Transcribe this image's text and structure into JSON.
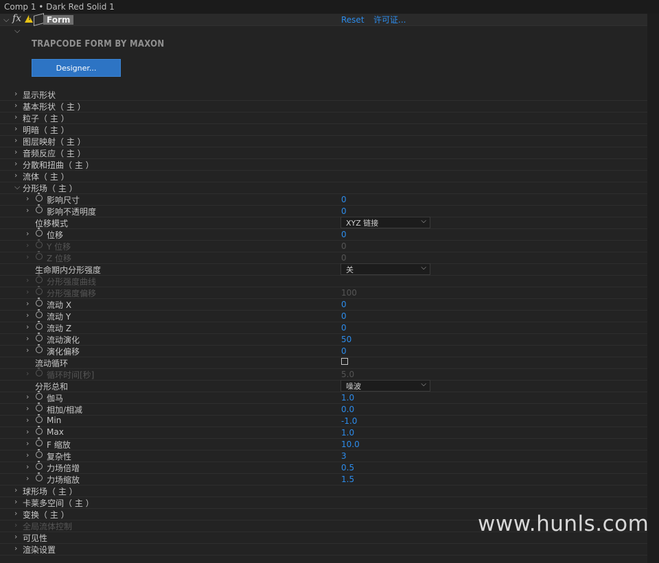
{
  "window": {
    "title": "Comp 1 • Dark Red Solid 1"
  },
  "effect": {
    "fx": "fx",
    "name": "Form",
    "reset": "Reset",
    "license": "许可证..."
  },
  "brand": "TRAPCODE FORM BY MAXON",
  "designer_button": "Designer...",
  "groups_top": [
    "显示形状",
    "基本形状（ 主 ）",
    "粒子（ 主 ）",
    "明暗（ 主 ）",
    "图层映射（ 主 ）",
    "音频反应（ 主 ）",
    "分散和扭曲（ 主 ）",
    "流体（ 主 ）"
  ],
  "fractal": {
    "label": "分形场（ 主 ）",
    "params": [
      {
        "label": "影响尺寸",
        "value": "0"
      },
      {
        "label": "影响不透明度",
        "value": "0"
      },
      {
        "label": "位移模式",
        "dropdown": "XYZ 链接"
      },
      {
        "label": "位移",
        "value": "0"
      },
      {
        "label": "Y 位移",
        "value": "0"
      },
      {
        "label": "Z 位移",
        "value": "0"
      },
      {
        "label": "生命期内分形强度",
        "dropdown": "关"
      },
      {
        "label": "分形强度曲线",
        "value": ""
      },
      {
        "label": "分形强度偏移",
        "value": "100"
      },
      {
        "label": "流动 X",
        "value": "0"
      },
      {
        "label": "流动 Y",
        "value": "0"
      },
      {
        "label": "流动 Z",
        "value": "0"
      },
      {
        "label": "流动演化",
        "value": "50"
      },
      {
        "label": "演化偏移",
        "value": "0"
      },
      {
        "label": "流动循环",
        "value": ""
      },
      {
        "label": "循环时间[秒]",
        "value": "5.0"
      },
      {
        "label": "分形总和",
        "dropdown": "噪波"
      },
      {
        "label": "伽马",
        "value": "1.0"
      },
      {
        "label": "相加/相减",
        "value": "0.0"
      },
      {
        "label": "Min",
        "value": "-1.0"
      },
      {
        "label": "Max",
        "value": "1.0"
      },
      {
        "label": "F 缩放",
        "value": "10.0"
      },
      {
        "label": "复杂性",
        "value": "3"
      },
      {
        "label": "力场倍增",
        "value": "0.5"
      },
      {
        "label": "力场缩放",
        "value": "1.5"
      }
    ]
  },
  "groups_bottom": [
    "球形场（ 主 ）",
    "卡莱多空间（ 主 ）",
    "变换（ 主 ）",
    "全局流体控制",
    "可见性",
    "渲染设置"
  ],
  "watermark": "www.hunls.com",
  "colors": {
    "accent": "#2d8ceb",
    "button": "#2d74c4",
    "warning": "#e7c316"
  }
}
